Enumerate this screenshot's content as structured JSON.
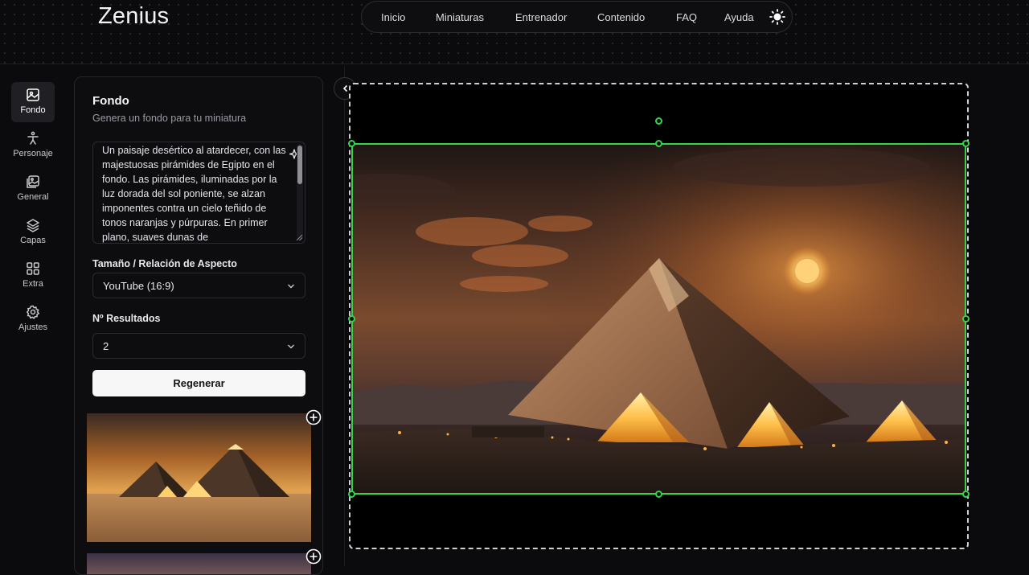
{
  "app": {
    "title": "Zenius"
  },
  "nav": {
    "items": [
      "Inicio",
      "Miniaturas",
      "Entrenador",
      "Contenido",
      "FAQ",
      "Ayuda"
    ],
    "theme_icon": "sun-icon"
  },
  "sidebar": {
    "items": [
      {
        "label": "Fondo",
        "icon": "image-icon",
        "active": true
      },
      {
        "label": "Personaje",
        "icon": "person-icon",
        "active": false
      },
      {
        "label": "General",
        "icon": "gallery-icon",
        "active": false
      },
      {
        "label": "Capas",
        "icon": "layers-icon",
        "active": false
      },
      {
        "label": "Extra",
        "icon": "grid-icon",
        "active": false
      },
      {
        "label": "Ajustes",
        "icon": "gear-icon",
        "active": false
      }
    ]
  },
  "panel": {
    "title": "Fondo",
    "subtitle": "Genera un fondo para tu miniatura",
    "prompt": "Un paisaje desértico al atardecer, con las majestuosas pirámides de Egipto en el fondo. Las pirámides, iluminadas por la luz dorada del sol poniente, se alzan imponentes contra un cielo teñido de tonos naranjas y púrpuras. En primer plano, suaves dunas de",
    "size_label": "Tamaño / Relación de Aspecto",
    "size_value": "YouTube (16:9)",
    "results_label": "Nº Resultados",
    "results_value": "2",
    "regenerate_label": "Regenerar"
  },
  "colors": {
    "accent_selection": "#35d44a",
    "background": "#0b0b0d",
    "button_bg": "#f7f7f8"
  }
}
